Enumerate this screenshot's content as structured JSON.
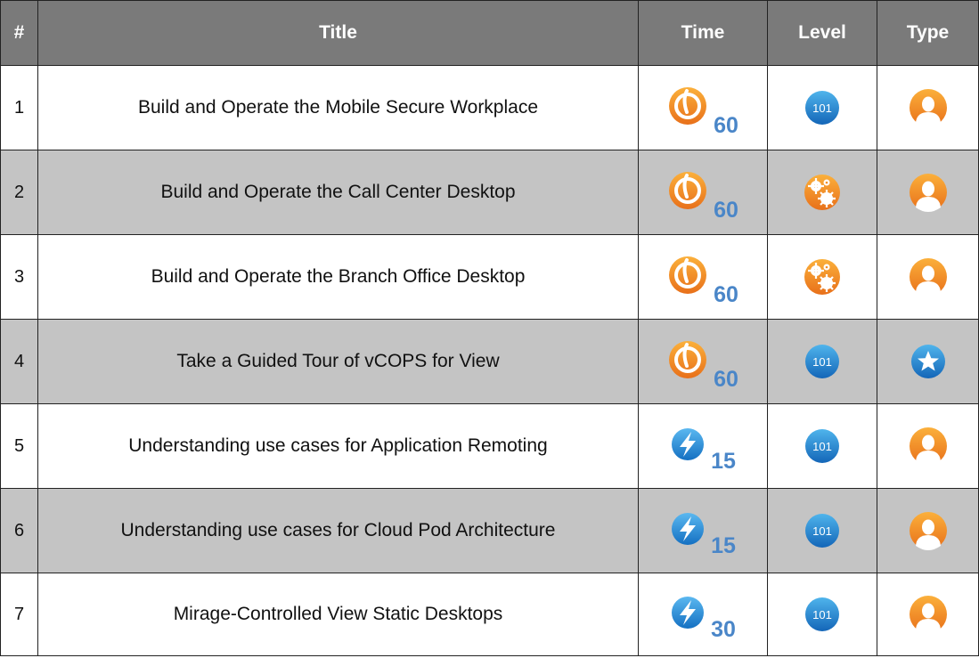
{
  "headers": [
    "#",
    "Title",
    "Time",
    "Level",
    "Type"
  ],
  "rows": [
    {
      "num": "1",
      "title": "Build and Operate the Mobile Secure Workplace",
      "time_icon": "clock-icon",
      "time": "60",
      "level_icon": "level-101-icon",
      "level_text": "101",
      "type_icon": "person-icon"
    },
    {
      "num": "2",
      "title": "Build and Operate the Call Center Desktop",
      "time_icon": "clock-icon",
      "time": "60",
      "level_icon": "gears-icon",
      "type_icon": "person-icon"
    },
    {
      "num": "3",
      "title": "Build and Operate the Branch Office Desktop",
      "time_icon": "clock-icon",
      "time": "60",
      "level_icon": "gears-icon",
      "type_icon": "person-icon"
    },
    {
      "num": "4",
      "title": "Take a Guided Tour of vCOPS for View",
      "time_icon": "clock-icon",
      "time": "60",
      "level_icon": "level-101-icon",
      "level_text": "101",
      "type_icon": "star-icon"
    },
    {
      "num": "5",
      "title": "Understanding use cases for Application Remoting",
      "time_icon": "lightning-icon",
      "time": "15",
      "level_icon": "level-101-icon",
      "level_text": "101",
      "type_icon": "person-icon"
    },
    {
      "num": "6",
      "title": "Understanding use cases for Cloud Pod Architecture",
      "time_icon": "lightning-icon",
      "time": "15",
      "level_icon": "level-101-icon",
      "level_text": "101",
      "type_icon": "person-icon"
    },
    {
      "num": "7",
      "title": "Mirage-Controlled View Static Desktops",
      "time_icon": "lightning-icon",
      "time": "30",
      "level_icon": "level-101-icon",
      "level_text": "101",
      "type_icon": "person-icon"
    }
  ],
  "colors": {
    "header_bg": "#7a7a7a",
    "row_alt_bg": "#c4c4c4",
    "time_text": "#4a86c8",
    "orange": "#f08a1c",
    "blue": "#1f88d4"
  }
}
